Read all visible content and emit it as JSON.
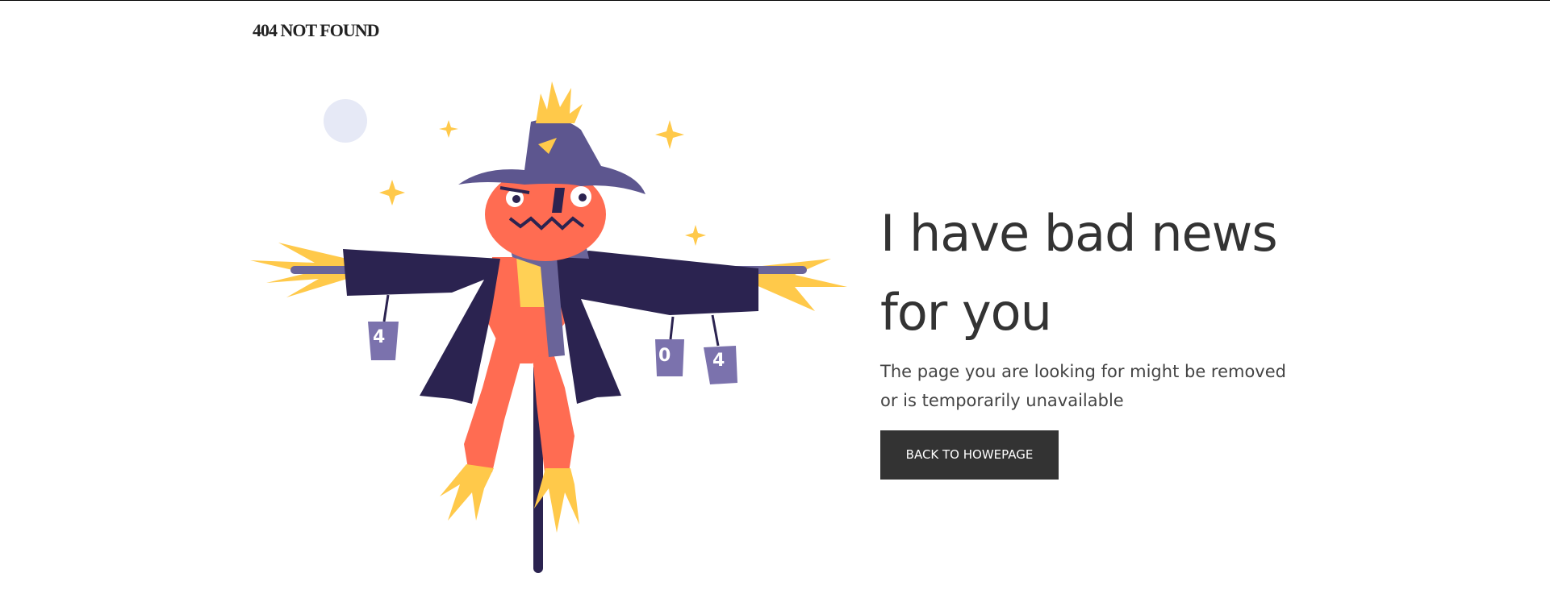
{
  "header": {
    "brand": "404 NOT FOUND"
  },
  "main": {
    "headline": "I have bad news for you",
    "subtext": "The page you are looking for might be removed or is temporarily unavailable",
    "button_label": "BACK TO HOWEPAGE"
  },
  "illustration": {
    "description_icon": "scarecrow-illustration",
    "can_labels": [
      "4",
      "0",
      "4"
    ]
  },
  "colors": {
    "text": "#333333",
    "button_bg": "#333333",
    "button_text": "#ffffff",
    "coat": "#2b2350",
    "hat": "#5d568f",
    "head": "#ff6c52",
    "straw": "#ffc94a",
    "moon": "#e6e9f6"
  }
}
